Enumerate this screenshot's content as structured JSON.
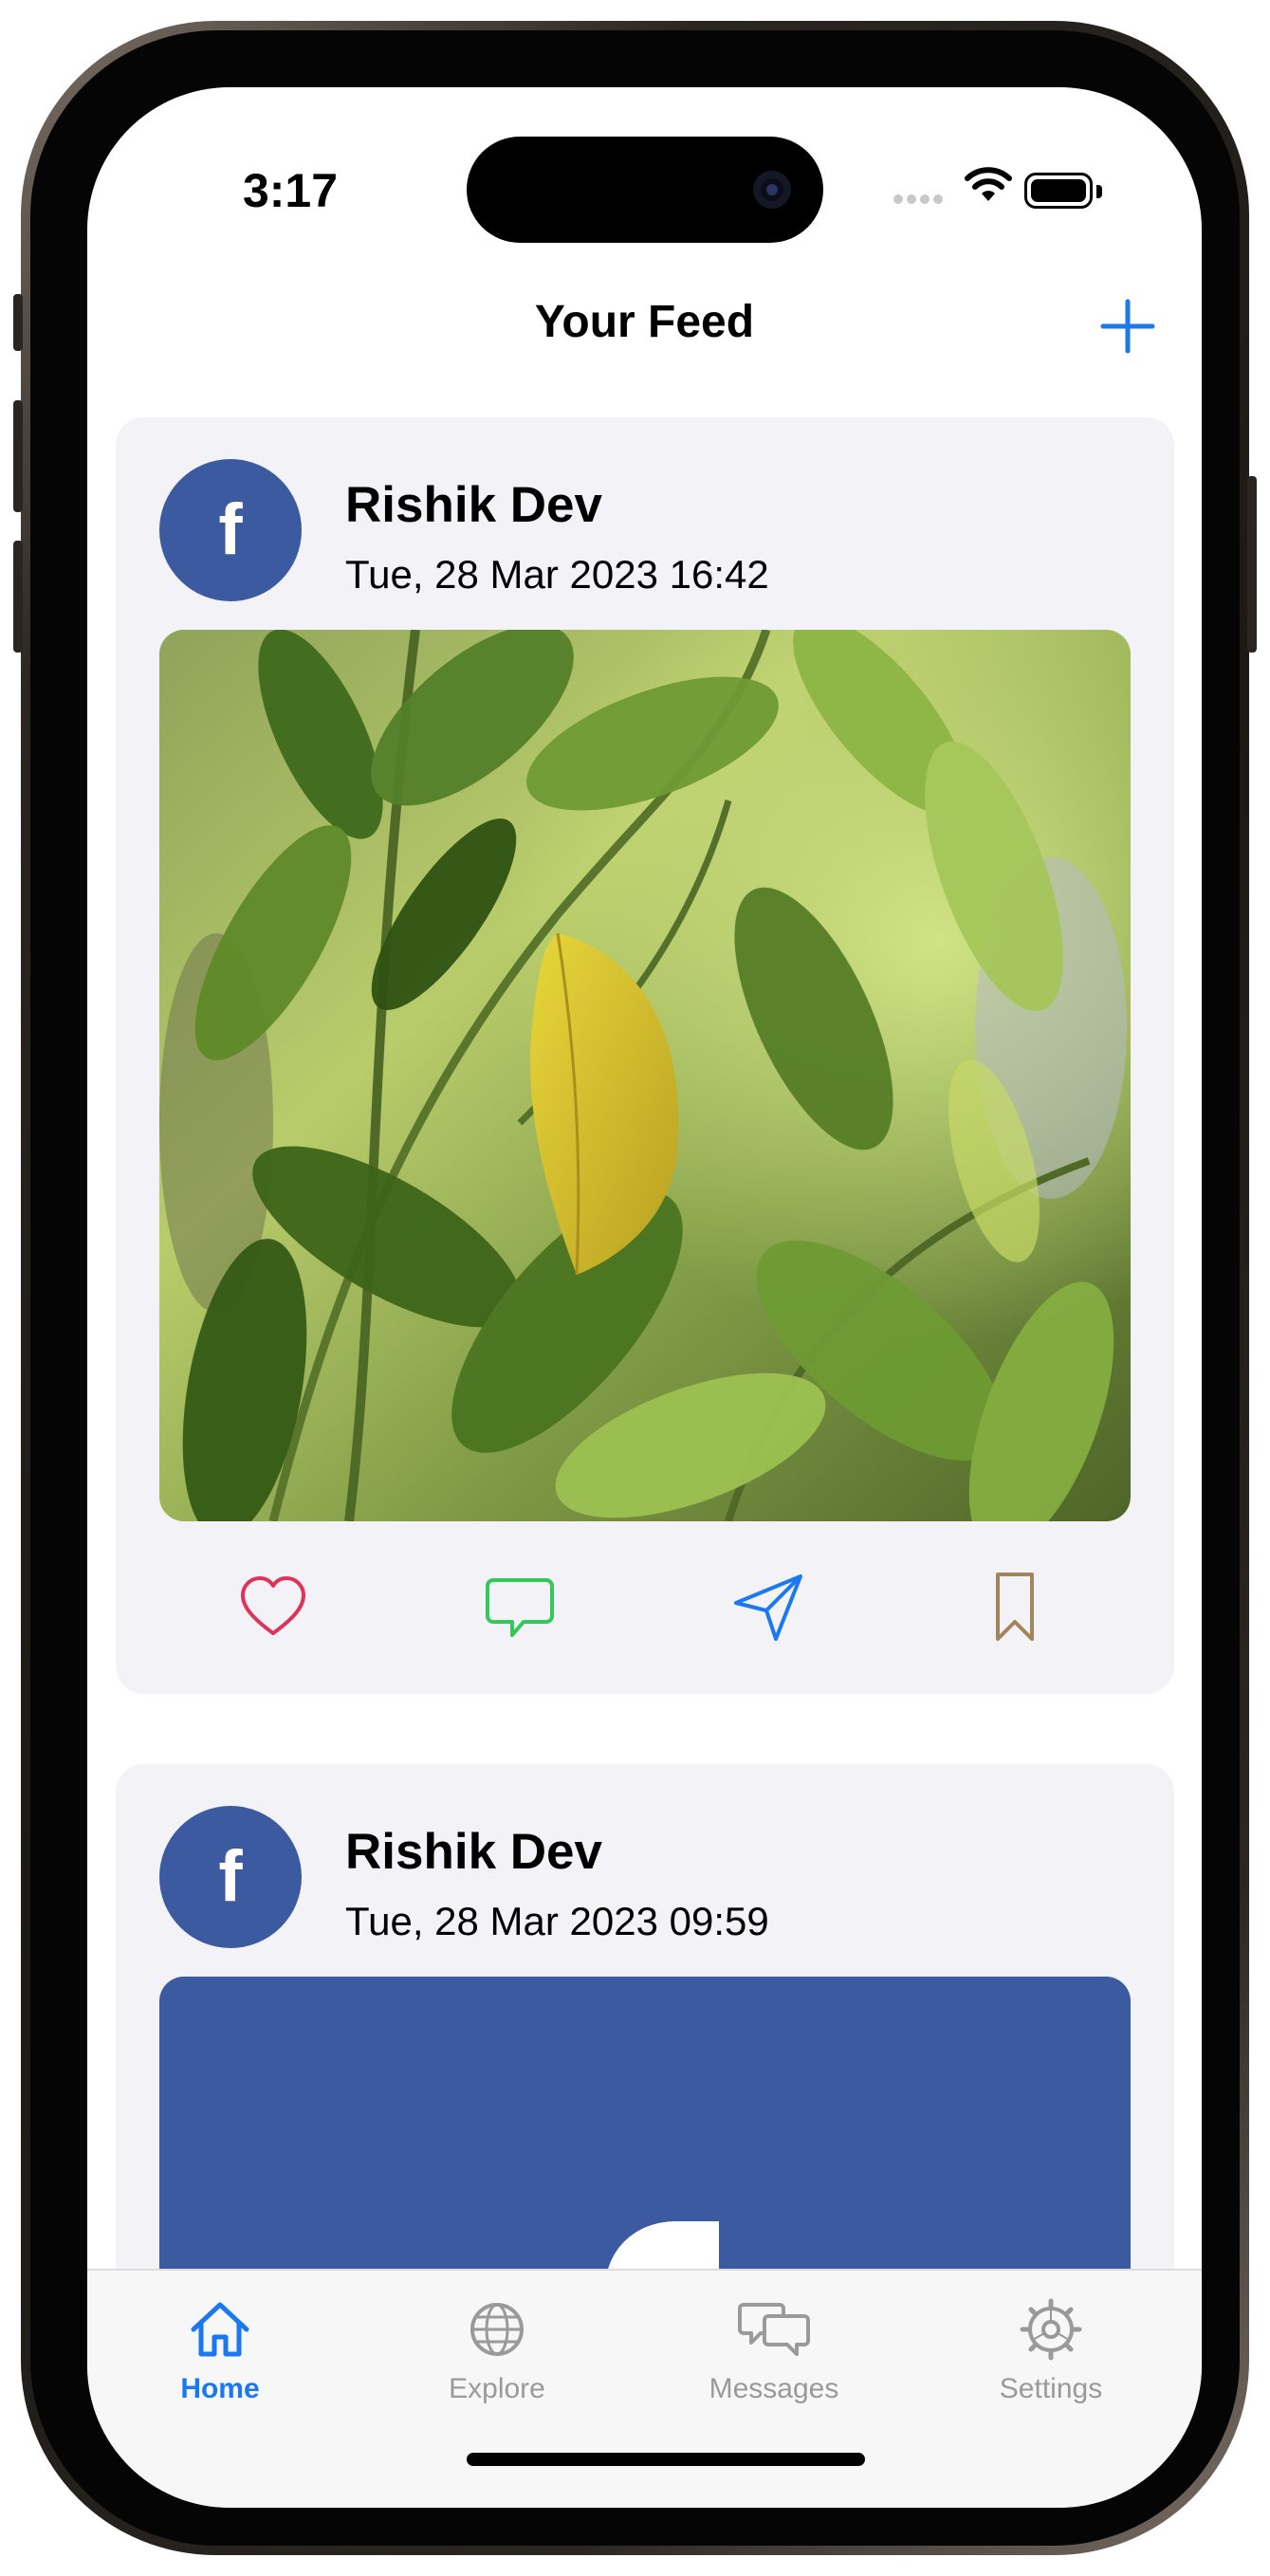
{
  "status_bar": {
    "time": "3:17"
  },
  "nav": {
    "title": "Your Feed",
    "add_icon": "plus-icon"
  },
  "posts": [
    {
      "author": "Rishik Dev",
      "timestamp": "Tue, 28 Mar 2023 16:42",
      "image": "green leaves photo",
      "avatar_letter": "f"
    },
    {
      "author": "Rishik Dev",
      "timestamp": "Tue, 28 Mar 2023 09:59",
      "image": "facebook logo",
      "avatar_letter": "f"
    }
  ],
  "actions": {
    "like_icon": "heart-icon",
    "comment_icon": "comment-icon",
    "share_icon": "send-icon",
    "save_icon": "bookmark-icon"
  },
  "tabs": [
    {
      "label": "Home",
      "icon": "house-icon",
      "active": true
    },
    {
      "label": "Explore",
      "icon": "globe-icon",
      "active": false
    },
    {
      "label": "Messages",
      "icon": "chat-bubbles-icon",
      "active": false
    },
    {
      "label": "Settings",
      "icon": "gear-icon",
      "active": false
    }
  ],
  "colors": {
    "accent": "#1a79f0",
    "facebook_blue": "#3b5aa0",
    "like": "#e0335a",
    "comment": "#34c759",
    "save": "#a2845e",
    "card_bg": "#f2f2f7"
  }
}
